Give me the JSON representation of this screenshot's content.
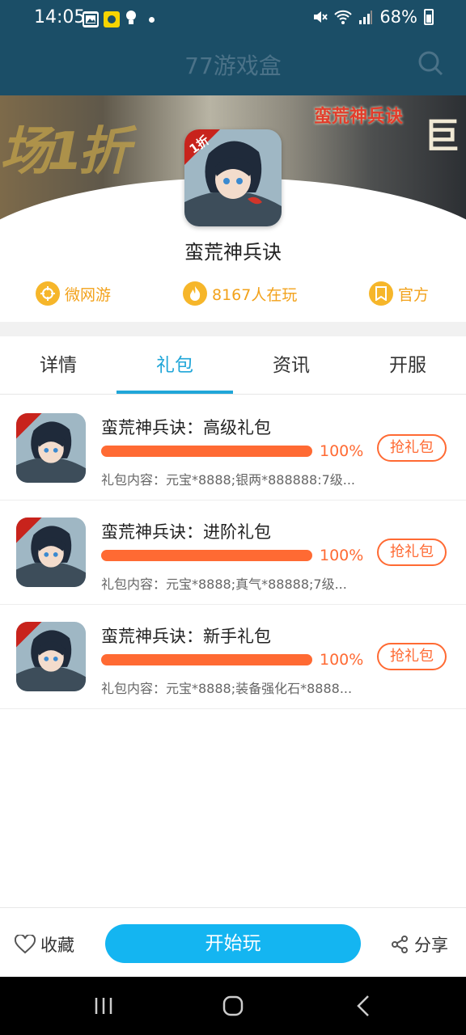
{
  "status": {
    "time": "14:05",
    "battery": "68%"
  },
  "header": {
    "title": "77游戏盒"
  },
  "banner": {
    "calligraphy": "场1折",
    "logo": "蛮荒神兵诀",
    "right_text": "巨"
  },
  "game": {
    "title": "蛮荒神兵诀",
    "badge": "1折",
    "meta": [
      {
        "icon": "target-icon",
        "label": "微网游"
      },
      {
        "icon": "fire-icon",
        "label": "8167人在玩"
      },
      {
        "icon": "bookmark-icon",
        "label": "官方"
      }
    ]
  },
  "tabs": [
    {
      "label": "详情",
      "active": false
    },
    {
      "label": "礼包",
      "active": true
    },
    {
      "label": "资讯",
      "active": false
    },
    {
      "label": "开服",
      "active": false
    }
  ],
  "gifts": [
    {
      "name": "蛮荒神兵诀：高级礼包",
      "progress": 100,
      "percent_text": "100%",
      "content": "礼包内容：元宝*8888;银两*888888:7级...",
      "button": "抢礼包"
    },
    {
      "name": "蛮荒神兵诀：进阶礼包",
      "progress": 100,
      "percent_text": "100%",
      "content": "礼包内容：元宝*8888;真气*88888;7级...",
      "button": "抢礼包"
    },
    {
      "name": "蛮荒神兵诀：新手礼包",
      "progress": 100,
      "percent_text": "100%",
      "content": "礼包内容：元宝*8888;装备强化石*8888...",
      "button": "抢礼包"
    }
  ],
  "bottom": {
    "favorite": "收藏",
    "play": "开始玩",
    "share": "分享"
  },
  "colors": {
    "accent": "#20a6d8",
    "play_button": "#14b5f1",
    "orange": "#ff6a33",
    "meta": "#f2a21b",
    "header": "#1b4e67"
  }
}
